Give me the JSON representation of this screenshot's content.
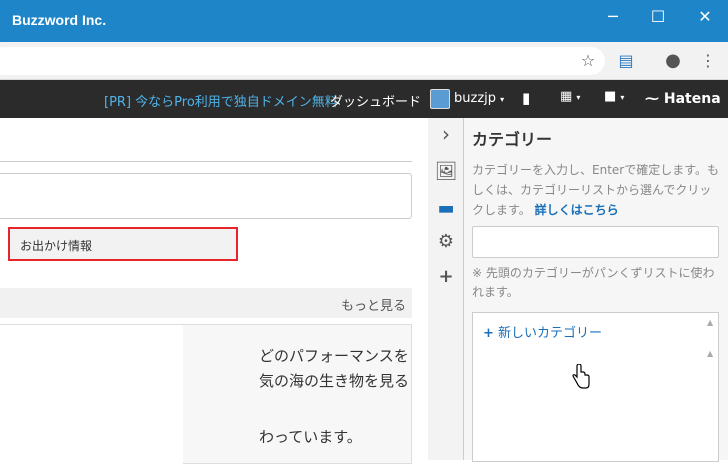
{
  "window": {
    "title": "Buzzword Inc.",
    "minimize": "─",
    "maximize": "☐",
    "close": "✕"
  },
  "toolbar": {
    "star_icon": "star-icon",
    "extension_icon": "extension-icon",
    "profile_icon": "profile-icon",
    "menu_icon": "menu-icon"
  },
  "hatena_bar": {
    "pr_link": "[PR] 今ならPro利用で独自ドメイン無料",
    "dashboard": "ダッシュボード",
    "username": "buzzjp",
    "logo": "Hatena"
  },
  "editor": {
    "more_label": "もっと見る",
    "preview_lines": [
      "どのパフォーマンスを",
      "気の海の生き物を見る",
      "わっています。"
    ]
  },
  "category_panel": {
    "title": "カテゴリー",
    "description": "カテゴリーを入力し、Enterで確定します。もしくは、カテゴリーリストから選んでクリックします。",
    "details_link": "詳しくはこちら",
    "note": "※ 先頭のカテゴリーがパンくずリストに使われます。",
    "new_category": "新しいカテゴリー",
    "categories": [
      "お出かけ情報"
    ]
  }
}
